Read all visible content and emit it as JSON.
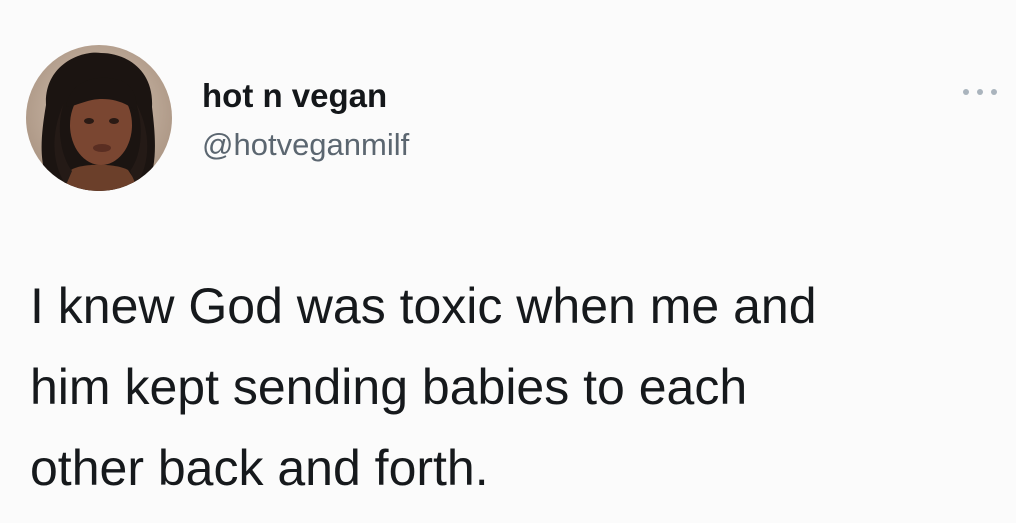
{
  "tweet": {
    "author": {
      "display_name": "hot n vegan",
      "handle": "@hotveganmilf",
      "avatar_icon": "profile-photo"
    },
    "menu_icon": "more-options-icon",
    "text": "I knew God was toxic when me and\nhim kept sending babies to each\nother back and forth."
  },
  "colors": {
    "background": "#fbfbfb",
    "text": "#14171a",
    "secondary_text": "#5b6670"
  }
}
